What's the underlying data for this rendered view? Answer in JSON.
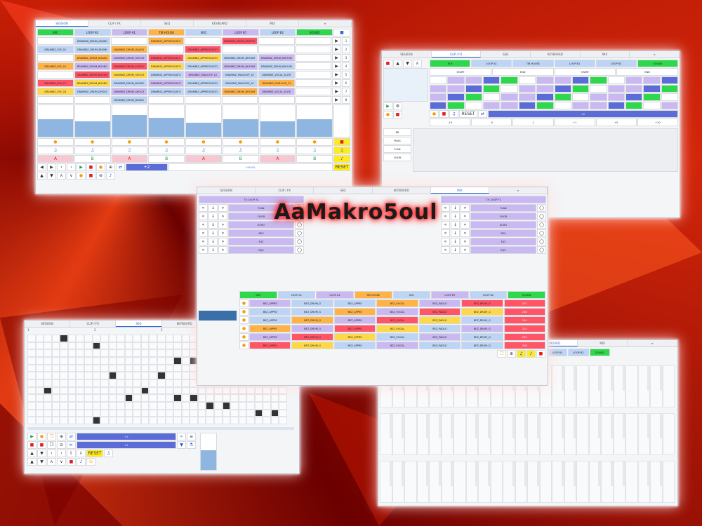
{
  "logo": "AaMakro5oul",
  "tabs": {
    "session": "SESSION",
    "clip_fx": "CLIP / FX",
    "seq": "SEQ",
    "keyboard": "KEYBOARD",
    "mix": "MIX"
  },
  "session_window": {
    "track_headers": [
      "SRC",
      "LOOP B2",
      "LOOP A1",
      "TIB HOUSE",
      "SEQ",
      "LOOP B7",
      "LOOP B2",
      "SOUND"
    ],
    "scene_numbers": [
      "1",
      "2",
      "3",
      "4",
      "5",
      "6",
      "7",
      "8"
    ],
    "clips": [
      [
        "",
        "DRAMBIZ_DRUM_ASHBO",
        "",
        "DRAMBIZ_APPREGGIATO",
        "",
        "DRAMBIZ_DRUM_BHATTO",
        "",
        ""
      ],
      [
        "DRAMBIZ_SFX_51",
        "DRAMBIZ_DRUM_BHOMI",
        "DRAMBIZ_DRUM_DAAOU",
        "",
        "DRAMBIZ_APPREGGIATO",
        "",
        "",
        ""
      ],
      [
        "",
        "DRAMBIZ_DRUM_BHANG",
        "DRAMBIZ_DRUM_SHOOZ",
        "DRAMBIZ_APPREGGIATO",
        "DRAMBIZ_APPREGGIATO",
        "DRAMBIZ_DRUM_BHOUM",
        "DRAMBIZ_DRUM_BHOUM",
        ""
      ],
      [
        "DRAMBIZ_SFX_15",
        "DRAMBIZ_DRUM_BHOBO",
        "DRAMBIZ_DRUM_CHITLO",
        "DRAMBIZ_APPREGGIATO",
        "DRAMBIZ_APPREGGIATO",
        "DRAMBIZ_DRUM_BHOUM",
        "DRAMBIZ_DRUM_BHOUM",
        ""
      ],
      [
        "",
        "DRAMBIZ_DRUM_BHOUM",
        "DRAMBIZ_DRUM_SHOOZ",
        "DRAMBIZ_APPREGGIATO",
        "DRAMBIZ_PADLOOP_10",
        "DRAMBIZ_PADLOOP_10",
        "DRAMBIZ_VOCAL_ELITE",
        ""
      ],
      [
        "DRAMBIZ_SFX_17",
        "DRAMBIZ_DRUM_BHOBO",
        "DRAMBIZ_DRUM_BHOBO",
        "DRAMBIZ_APPREGGIATO",
        "DRAMBIZ_APPREGGIATO",
        "DRAMBIZ_PADLOOP_10",
        "DRAMBIZ_PADLOOP_13",
        ""
      ],
      [
        "DRAMBIZ_SFX_18",
        "DRAMBIZ_DRUM_DHOLE",
        "DRAMBIZ_DRUM_SHOOZ",
        "DRAMBIZ_APPREGGIATO",
        "DRAMBIZ_APPREGGIATO",
        "DRAMBIZ_DRUM_BHOUM",
        "DRAMBIZ_VOCAL_ELITE",
        ""
      ],
      [
        "",
        "",
        "DRAMBIZ_DRUM_BHASO",
        "",
        "",
        "",
        "",
        ""
      ]
    ],
    "sound_values": [
      "2N",
      "207",
      "",
      "208",
      "209",
      "",
      "206",
      "206"
    ],
    "volumes": [
      0.55,
      0.5,
      0.7,
      0.6,
      0.45,
      0.55,
      0.5,
      0.55
    ],
    "ab": [
      "A",
      "B",
      "A",
      "B",
      "A",
      "B",
      "A",
      "B"
    ],
    "reset_label": "RESET",
    "plus2": "+2",
    "zoom": "100.0%"
  },
  "clipfx_window": {
    "tracks": [
      "M B",
      "LOOP A1",
      "TIB HOUSE",
      "LOOP B1",
      "LOOP B2",
      "SOUND"
    ],
    "start_end": [
      "START",
      "END",
      "START",
      "END"
    ],
    "reset": "RESET",
    "plus2": "+2",
    "numbers": [
      "-10",
      "-5",
      "-1",
      "+1",
      "+5",
      "+10"
    ],
    "sidebar": [
      "BR",
      "PHAS",
      "FLAN",
      "CHOR"
    ],
    "values": [
      "+2",
      "+2",
      "+2"
    ]
  },
  "mix_window": {
    "track_label": "T3: LOOP A1",
    "track_label_right": "T3: LOOP F1",
    "fx_labels": [
      "FLAN",
      "CHOR",
      "ECHO",
      "REV",
      "FILT",
      "EQ3"
    ],
    "track_headers": [
      "SRC",
      "LOOP A1",
      "LOOP A1",
      "TIB HOUSE",
      "SEQ",
      "LOOP B7",
      "LOOP B2",
      "SOUND"
    ],
    "clips": [
      "BEZ_APPRE",
      "BEZ_DRUM_G",
      "BEZ_APPRE",
      "BEZ_VOCAL",
      "BEZ_PADLO",
      "BEZ_DRUM_G"
    ],
    "values": [
      "297",
      "208",
      "204",
      "204"
    ],
    "ab": [
      "A",
      "B"
    ],
    "plus2": "+2"
  },
  "seq_window": {
    "bars": [
      "1",
      "2",
      "3",
      "4"
    ],
    "plus2": "+2",
    "reset": "RESET",
    "plus2b": "+2"
  },
  "keyboard_window": {
    "tracks": [
      "LOOP B1",
      "LOOP B2",
      "SOUND"
    ]
  }
}
